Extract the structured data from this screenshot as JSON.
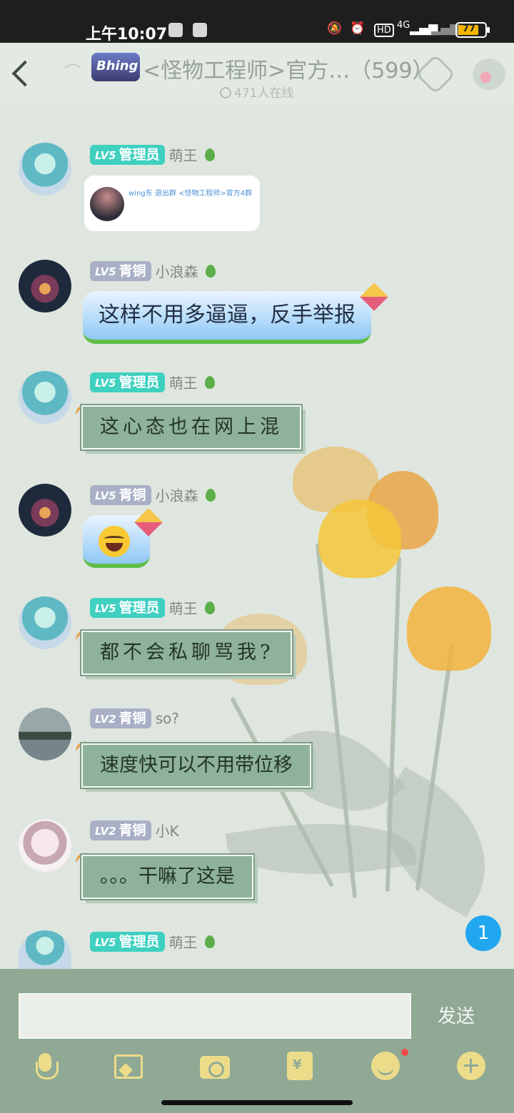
{
  "status_bar": {
    "time": "上午10:07",
    "network": "4G",
    "battery": "77"
  },
  "header": {
    "logo_text": "Bhing",
    "group_name": "<怪物工程师>官方…（599）",
    "online_text": "471人在线"
  },
  "messages": [
    {
      "level": "LV5",
      "role": "管理员",
      "nick": "萌王",
      "type": "card",
      "card_text": "wing东 退出群 <怪物工程师>官方4群"
    },
    {
      "level": "LV5",
      "role": "青铜",
      "nick": "小浪森",
      "type": "blue",
      "text": "这样不用多逼逼，反手举报"
    },
    {
      "level": "LV5",
      "role": "管理员",
      "nick": "萌王",
      "type": "green",
      "text": "这心态也在网上混"
    },
    {
      "level": "LV5",
      "role": "青铜",
      "nick": "小浪森",
      "type": "emoji",
      "emoji": "face-with-tears-of-joy"
    },
    {
      "level": "LV5",
      "role": "管理员",
      "nick": "萌王",
      "type": "green",
      "text": "都不会私聊骂我?"
    },
    {
      "level": "LV2",
      "role": "青铜",
      "nick": "so?",
      "type": "green",
      "text": "速度快可以不用带位移"
    },
    {
      "level": "LV2",
      "role": "青铜",
      "nick": "小K",
      "type": "green",
      "text": "。。。干嘛了这是"
    },
    {
      "level": "LV5",
      "role": "管理员",
      "nick": "萌王",
      "type": "partial"
    }
  ],
  "unread_count": "1",
  "composer": {
    "input_value": "",
    "send_label": "发送"
  },
  "toolbar": {
    "icons": [
      "microphone-icon",
      "image-icon",
      "camera-icon",
      "red-packet-icon",
      "emoji-icon",
      "plus-icon"
    ],
    "red_packet_glyph": "¥"
  },
  "colors": {
    "admin_badge": "#3fd0c0",
    "bronze_badge": "#a9b0c6",
    "bubble_green": "#8fb29a",
    "unread": "#21a7f0"
  }
}
